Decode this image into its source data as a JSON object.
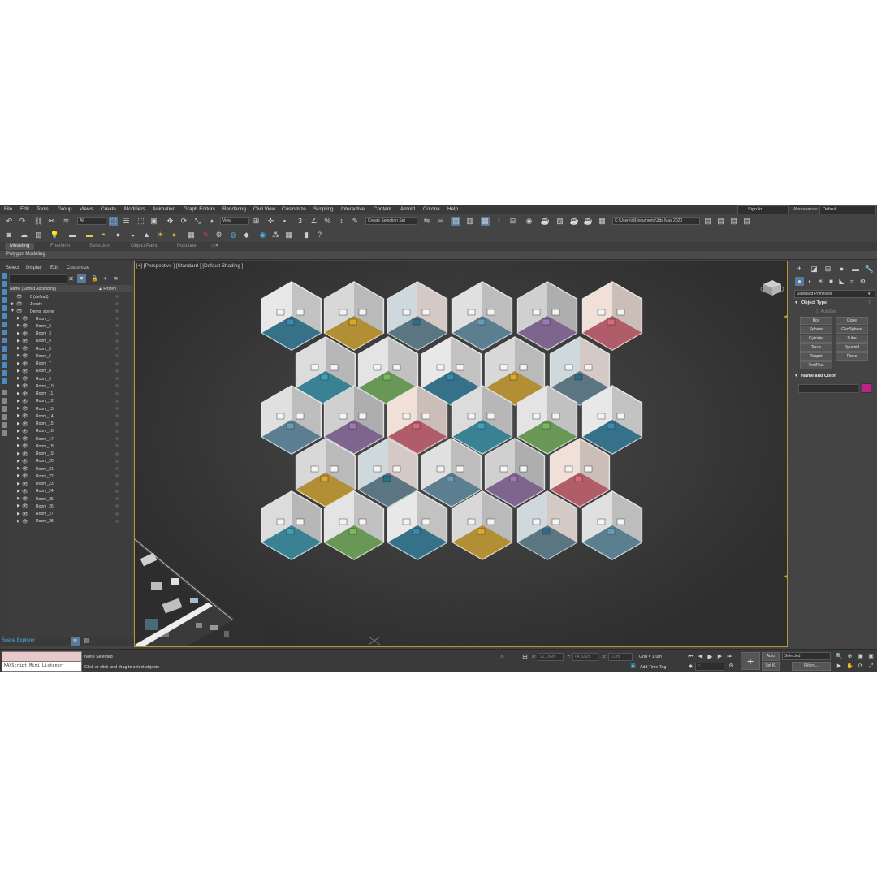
{
  "menu": [
    "File",
    "Edit",
    "Tools",
    "Group",
    "Views",
    "Create",
    "Modifiers",
    "Animation",
    "Graph Editors",
    "Rendering",
    "Civil View",
    "Customize",
    "Scripting",
    "Interactive",
    "Content",
    "Arnold",
    "Corona",
    "Help"
  ],
  "signin": "Sign In",
  "workspaces_label": "Workspaces:",
  "workspace": "Default",
  "toolbar": {
    "filter": "All",
    "refcoord": "View",
    "selection_set": "Create Selection Set",
    "project_path": "C:\\Users\\d\\Documents\\3ds Max 2020"
  },
  "ribbon_tabs": [
    "Modeling",
    "Freeform",
    "Selection",
    "Object Paint",
    "Populate"
  ],
  "ribbon_sub": "Polygon Modeling",
  "scene_explorer": {
    "menu": [
      "Select",
      "Display",
      "Edit",
      "Customize"
    ],
    "col_name": "Name (Sorted Ascending)",
    "col_frozen": "▲ Frozen",
    "top_items": [
      "0 (default)",
      "Assets",
      "Demo_scene"
    ],
    "rooms": [
      "Room_1",
      "Room_2",
      "Room_3",
      "Room_4",
      "Room_5",
      "Room_6",
      "Room_7",
      "Room_8",
      "Room_9",
      "Room_10",
      "Room_11",
      "Room_12",
      "Room_13",
      "Room_14",
      "Room_15",
      "Room_16",
      "Room_17",
      "Room_18",
      "Room_19",
      "Room_20",
      "Room_21",
      "Room_22",
      "Room_23",
      "Room_24",
      "Room_25",
      "Room_26",
      "Room_27",
      "Room_28"
    ],
    "footer": "Scene Explorer"
  },
  "viewport": {
    "label": "[+] [Perspective ] [Standard ] [Default Shading ]"
  },
  "command_panel": {
    "category": "Standard Primitives",
    "object_type": "Object Type",
    "autogrid": "AutoGrid",
    "primitives": [
      "Box",
      "Cone",
      "Sphere",
      "GeoSphere",
      "Cylinder",
      "Tube",
      "Torus",
      "Pyramid",
      "Teapot",
      "Plane",
      "TextPlus"
    ],
    "name_and_color": "Name and Color",
    "object_color": "#c0208a"
  },
  "status": {
    "maxscript": "MAXScript Mini Listener",
    "selection": "None Selected",
    "prompt": "Click or click-and-drag to select objects",
    "x_label": "X:",
    "x": "92,156m",
    "y_label": "Y:",
    "y": "64,321m",
    "z_label": "Z:",
    "z": "0,0m",
    "grid": "Grid = 1,0m",
    "add_time_tag": "Add Time Tag",
    "auto": "Auto",
    "set_key": "Set K.",
    "key_filter": "Selected",
    "filters": "Filters...",
    "frame": "0"
  },
  "colors": {
    "accent": "#5a7a9a",
    "viewport_border": "#b49a32",
    "link": "#4ab0e8"
  }
}
